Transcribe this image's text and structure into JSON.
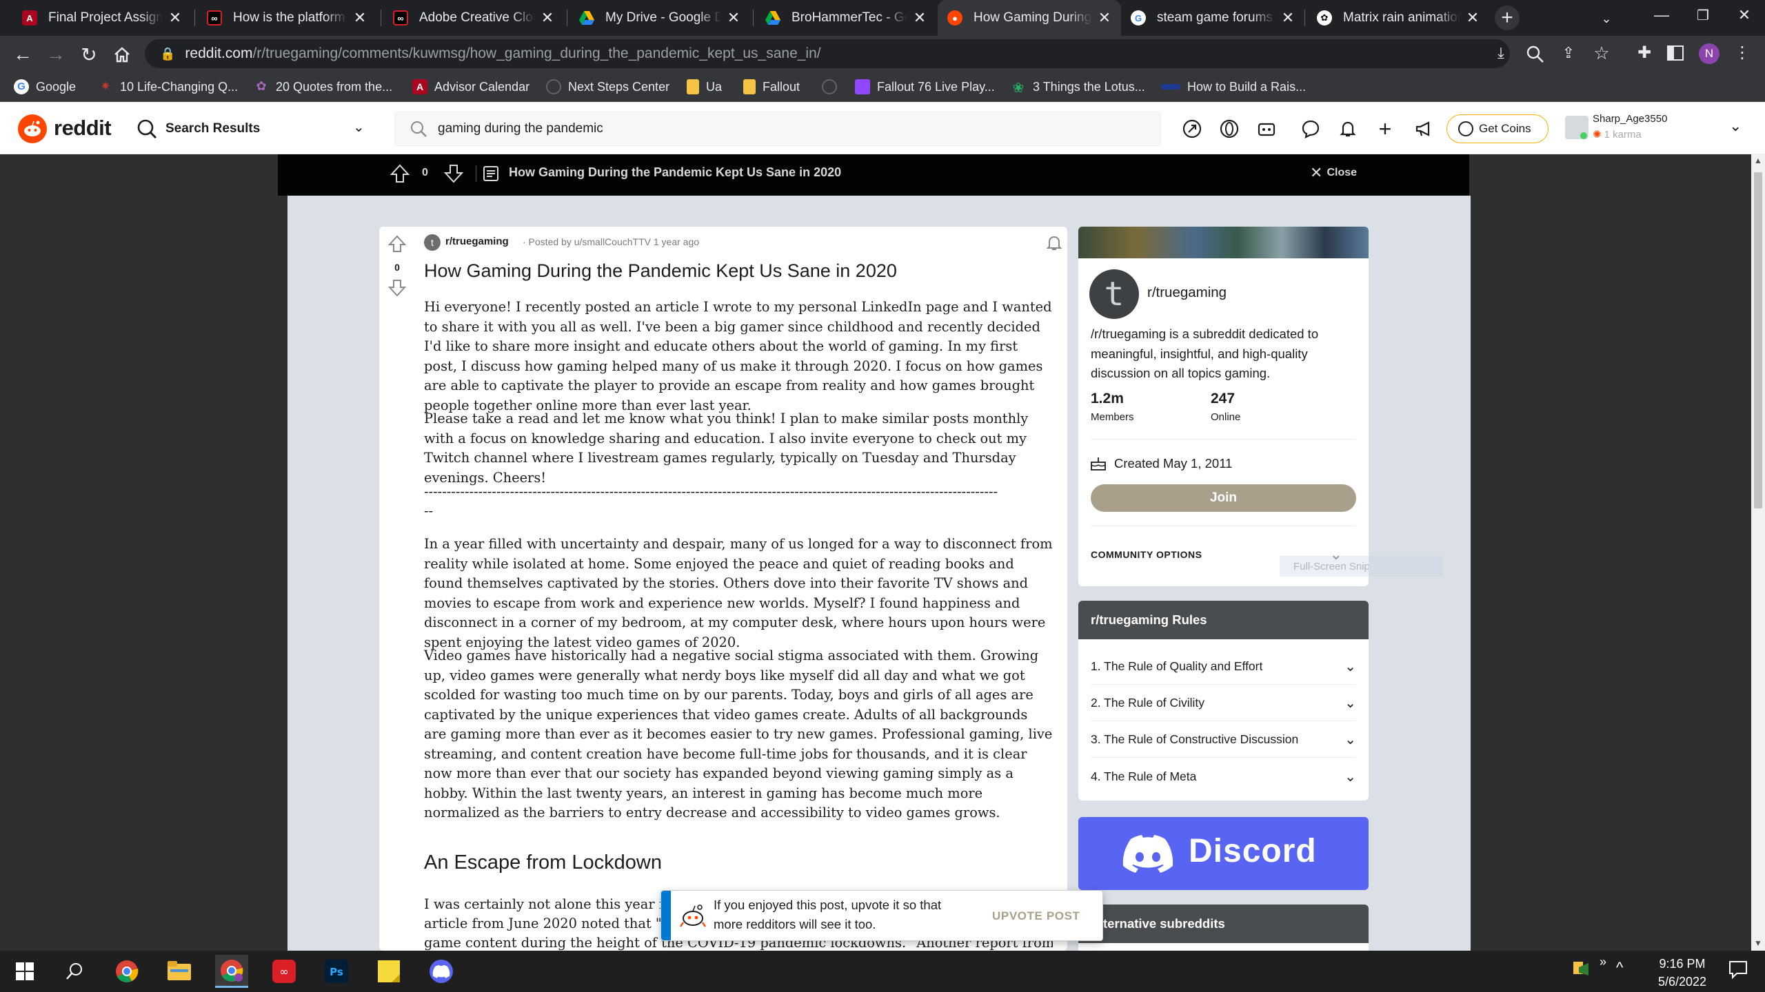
{
  "browser": {
    "tabs": [
      {
        "title": "Final Project Assignm",
        "favicon": "arizona-icon",
        "color": "#ab0520"
      },
      {
        "title": "How is the platform T",
        "favicon": "creative-cloud-icon",
        "color": "#000000"
      },
      {
        "title": "Adobe Creative Cloud",
        "favicon": "creative-cloud-icon",
        "color": "#000000"
      },
      {
        "title": "My Drive - Google Dr",
        "favicon": "google-drive-icon",
        "color": "#1fa463"
      },
      {
        "title": "BroHammerTec - Goo",
        "favicon": "google-drive-icon",
        "color": "#1fa463"
      },
      {
        "title": "How Gaming During",
        "favicon": "reddit-icon",
        "color": "#ff4500"
      },
      {
        "title": "steam game forums",
        "favicon": "google-icon",
        "color": "#4285f4"
      },
      {
        "title": "Matrix rain animation",
        "favicon": "openai-icon",
        "color": "#ffffff"
      }
    ],
    "url_domain": "reddit.com",
    "url_path": "/r/truegaming/comments/kuwmsg/how_gaming_during_the_pandemic_kept_us_sane_in/",
    "profile_initial": "N",
    "bookmarks": [
      {
        "label": "Google",
        "icon": "google-icon",
        "color": "#4285f4"
      },
      {
        "label": "10 Life-Changing Q...",
        "icon": "bookmark-icon",
        "color": "#c0392b"
      },
      {
        "label": "20 Quotes from the...",
        "icon": "bookmark-icon",
        "color": "#8e44ad"
      },
      {
        "label": "Advisor Calendar",
        "icon": "arizona-icon",
        "color": "#ab0520"
      },
      {
        "label": "Next Steps Center",
        "icon": "globe-icon",
        "color": "#5f6368"
      },
      {
        "label": "Ua",
        "icon": "folder-icon",
        "color": "#f6c344"
      },
      {
        "label": "Fallout",
        "icon": "folder-icon",
        "color": "#f6c344"
      },
      {
        "label": "",
        "icon": "globe-icon",
        "color": "#5f6368"
      },
      {
        "label": "Fallout 76 Live Play...",
        "icon": "twitch-icon",
        "color": "#9146ff"
      },
      {
        "label": "3 Things the Lotus...",
        "icon": "lotus-icon",
        "color": "#27ae60"
      },
      {
        "label": "How to Build a Rais...",
        "icon": "bookmark-icon",
        "color": "#2c3e50"
      }
    ]
  },
  "reddit": {
    "logo_text": "reddit",
    "nav_dropdown": "Search Results",
    "search_value": "gaming during the pandemic",
    "get_coins": "Get Coins",
    "username": "Sharp_Age3550",
    "karma": "1 karma",
    "brand_color": "#ff4500"
  },
  "overlay": {
    "vote_count": "0",
    "title": "How Gaming During the Pandemic Kept Us Sane in 2020",
    "close_label": "Close"
  },
  "post": {
    "subreddit": "r/truegaming",
    "posted_by": "· Posted by u/smallCouchTTV",
    "age": "1 year ago",
    "vote_count": "0",
    "title": "How Gaming During the Pandemic Kept Us Sane in 2020",
    "p1": "Hi everyone! I recently posted an article I wrote to my personal LinkedIn page and I wanted to share it with you all as well. I've been a big gamer since childhood and recently decided I'd like to share more insight and educate others about the world of gaming. In my first post, I discuss how gaming helped many of us make it through 2020. I focus on how games are able to captivate the player to provide an escape from reality and how games brought people together online more than ever last year.",
    "p2": "Please take a read and let me know what you think! I plan to make similar posts monthly with a focus on knowledge sharing and education. I also invite everyone to check out my Twitch channel where I livestream games regularly, typically on Tuesday and Thursday evenings. Cheers!",
    "divider": "-------------------------------------------------------------------------------------------------------------------------------",
    "divider_tail": "--",
    "p3": "In a year filled with uncertainty and despair, many of us longed for a way to disconnect from reality while isolated at home. Some enjoyed the peace and quiet of reading books and found themselves captivated by the stories. Others dove into their favorite TV shows and movies to escape from work and experience new worlds. Myself? I found happiness and disconnect in a corner of my bedroom, at my computer desk, where hours upon hours were spent enjoying the latest video games of 2020.",
    "p4": "Video games have historically had a negative social stigma associated with them. Growing up, video games were generally what nerdy boys like myself did all day and what we got scolded for wasting too much time on by our parents. Today, boys and girls of all ages are captivated by the unique experiences that video games create. Adults of all backgrounds are gaming more than ever as it becomes easier to try new games. Professional gaming, live streaming, and content creation have become full-time jobs for thousands, and it is clear now more than ever that our society has expanded beyond viewing gaming simply as a hobby. Within the last twenty years, an interest in gaming has become much more normalized as the barriers to entry decrease and accessibility to video games grows.",
    "heading": "An Escape from Lockdown",
    "p5_line1": "I was certainly not alone this year indul",
    "p5_line2": "article from June 2020 noted that \"82%",
    "p5_line3": "game content during the height of the COVID-19 pandemic lockdowns.\" Another report from Deloitte"
  },
  "about": {
    "name": "r/truegaming",
    "description": "/r/truegaming is a subreddit dedicated to meaningful, insightful, and high-quality discussion on all topics gaming.",
    "members_value": "1.2m",
    "members_label": "Members",
    "online_value": "247",
    "online_label": "Online",
    "created": "Created May 1, 2011",
    "join": "Join",
    "community_options": "COMMUNITY OPTIONS",
    "snip_tooltip": "Full-Screen Snip"
  },
  "rules": {
    "header": "r/truegaming Rules",
    "items": [
      "1. The Rule of Quality and Effort",
      "2. The Rule of Civility",
      "3. The Rule of Constructive Discussion",
      "4. The Rule of Meta"
    ]
  },
  "discord": {
    "label": "Discord"
  },
  "alt_subs": {
    "header": "Alternative subreddits",
    "visible": "ternative subreddits"
  },
  "toast": {
    "line1": "If you enjoyed this post, upvote it so that",
    "line2": "more redditors will see it too.",
    "button": "UPVOTE POST"
  },
  "taskbar": {
    "time": "9:16 PM",
    "date": "5/6/2022",
    "apps": [
      "windows-start-icon",
      "search-icon",
      "chrome-icon",
      "file-explorer-icon",
      "chrome-profile-icon",
      "creative-cloud-icon",
      "photoshop-icon",
      "sticky-notes-icon",
      "discord-icon"
    ]
  }
}
